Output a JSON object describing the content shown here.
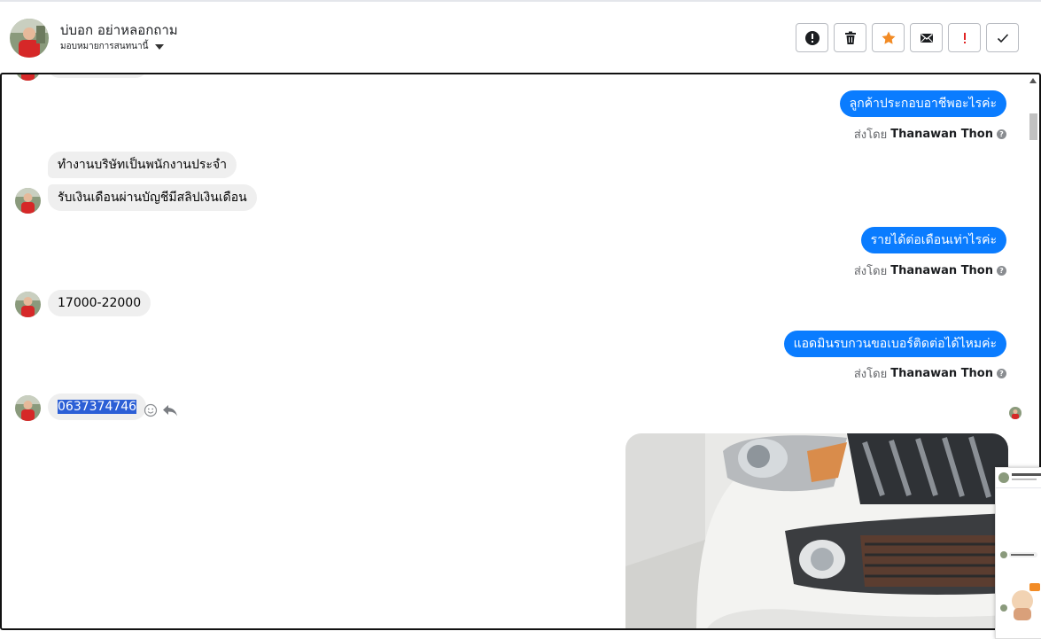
{
  "header": {
    "name": "บ่บอก อย่าหลอกถาม",
    "assign_label": "มอบหมายการสนทนานี้"
  },
  "actions": [
    {
      "icon": "alert-circle-icon",
      "color": "#1c1e21"
    },
    {
      "icon": "trash-icon",
      "color": "#1c1e21"
    },
    {
      "icon": "star-icon",
      "color": "#f28b25"
    },
    {
      "icon": "mail-icon",
      "color": "#1c1e21"
    },
    {
      "icon": "exclamation-icon",
      "color": "#e02424"
    },
    {
      "icon": "check-icon",
      "color": "#1c1e21"
    }
  ],
  "messages": {
    "out1": "ลูกค้าประกอบอาชีพอะไรค่ะ",
    "in1": "ทำงานบริษัทเป็นพนักงานประจำ",
    "in2": "รับเงินเดือนผ่านบัญชีมีสลิปเงินเดือน",
    "out2": "รายได้ต่อเดือนเท่าไรค่ะ",
    "in3": "17000-22000",
    "out3": "แอดมินรบกวนขอเบอร์ติดต่อได้ไหมค่ะ",
    "in4": "0637374746"
  },
  "sent_by": {
    "prefix": "ส่งโดย",
    "agent": "Thanawan Thon"
  },
  "colors": {
    "outgoing_bubble": "#0a7cff",
    "incoming_bubble": "#efefef",
    "selection": "#2c5fd6"
  }
}
